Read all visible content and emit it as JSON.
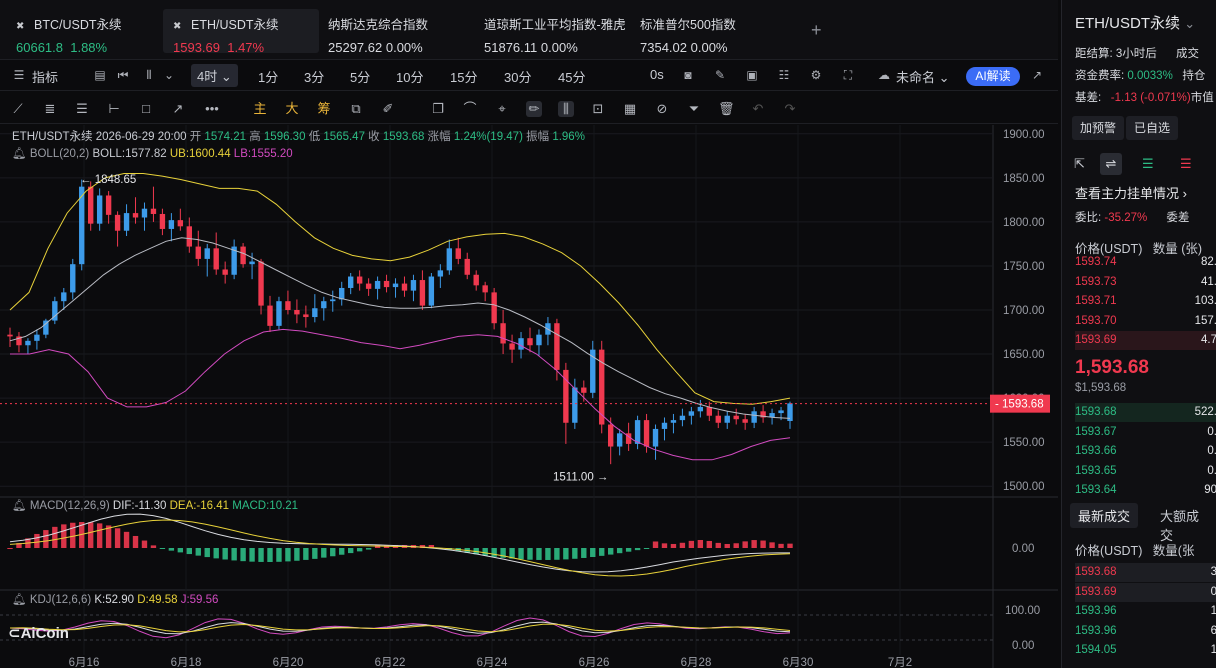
{
  "tabs": [
    {
      "name": "BTC/USDT永续",
      "price": "60661.8",
      "change": "1.88%",
      "dir": "up",
      "closable": true
    },
    {
      "name": "ETH/USDT永续",
      "price": "1593.69",
      "change": "1.47%",
      "dir": "down",
      "closable": true,
      "active": true
    },
    {
      "name": "纳斯达克综合指数",
      "price": "25297.62",
      "change": "0.00%",
      "dir": "flat"
    },
    {
      "name": "道琼斯工业平均指数-雅虎",
      "price": "51876.11",
      "change": "0.00%",
      "dir": "flat"
    },
    {
      "name": "标准普尔500指数",
      "price": "7354.02",
      "change": "0.00%",
      "dir": "flat"
    }
  ],
  "toolbar": {
    "indicator_label": "指标",
    "interval_selected": "4时",
    "intervals": [
      "1分",
      "3分",
      "5分",
      "10分",
      "15分",
      "30分",
      "45分"
    ],
    "interval_0s": "0s",
    "layout_name": "未命名",
    "ai_label": "AI解读"
  },
  "draw_tools": {
    "main": "主",
    "big": "大",
    "chip": "筹"
  },
  "legend": {
    "symbol": "ETH/USDT永续",
    "time": "2026-06-29 20:00",
    "open_label": "开",
    "open": "1574.21",
    "high_label": "高",
    "high": "1596.30",
    "low_label": "低",
    "low": "1565.47",
    "close_label": "收",
    "close": "1593.68",
    "chg_label": "涨幅",
    "chg": "1.24%(19.47)",
    "amp_label": "振幅",
    "amp": "1.96%",
    "boll_name": "BOLL(20,2)",
    "boll_val": "BOLL:1577.82",
    "boll_ub": "UB:1600.44",
    "boll_lb": "LB:1555.20",
    "macd_name": "MACD(12,26,9)",
    "macd_dif": "DIF:-11.30",
    "macd_dea": "DEA:-16.41",
    "macd_macd": "MACD:10.21",
    "kdj_name": "KDJ(12,6,6)",
    "kdj_k": "K:52.90",
    "kdj_d": "D:49.58",
    "kdj_j": "J:59.56"
  },
  "logo_text": "AiCoin",
  "colors": {
    "up": "#2dbd85",
    "down": "#f0394f",
    "candle_up": "#3d9be9",
    "candle_down": "#f0394f",
    "boll_mid": "#b9bcc4",
    "boll_ub": "#e8d23a",
    "boll_lb": "#d24bc0"
  },
  "chart_data": {
    "type": "candlestick",
    "price_axis_ticks": [
      "1900.00",
      "1850.00",
      "1800.00",
      "1750.00",
      "1700.00",
      "1650.00",
      "1600.00",
      "1550.00",
      "1500.00"
    ],
    "price_range": [
      1490,
      1910
    ],
    "current_price_label": "1593.68",
    "high_marker": "← 1848.65",
    "low_marker": "1511.00 →",
    "macd_axis_label": "0.00",
    "kdj_axis_ticks": [
      "100.00",
      "0.00"
    ],
    "x_labels": [
      "6月16",
      "6月18",
      "6月20",
      "6月22",
      "6月24",
      "6月26",
      "6月28",
      "6月30",
      "7月2"
    ],
    "candles": [
      [
        1672,
        1680,
        1658,
        1670
      ],
      [
        1670,
        1675,
        1652,
        1660
      ],
      [
        1660,
        1668,
        1650,
        1665
      ],
      [
        1665,
        1678,
        1655,
        1672
      ],
      [
        1672,
        1690,
        1668,
        1688
      ],
      [
        1688,
        1715,
        1684,
        1710
      ],
      [
        1710,
        1725,
        1700,
        1720
      ],
      [
        1720,
        1758,
        1712,
        1752
      ],
      [
        1752,
        1848,
        1745,
        1840
      ],
      [
        1840,
        1846,
        1790,
        1798
      ],
      [
        1798,
        1838,
        1790,
        1830
      ],
      [
        1830,
        1835,
        1798,
        1808
      ],
      [
        1808,
        1812,
        1772,
        1790
      ],
      [
        1790,
        1820,
        1784,
        1810
      ],
      [
        1810,
        1828,
        1798,
        1805
      ],
      [
        1805,
        1822,
        1790,
        1815
      ],
      [
        1815,
        1840,
        1800,
        1809
      ],
      [
        1809,
        1815,
        1785,
        1792
      ],
      [
        1792,
        1810,
        1778,
        1802
      ],
      [
        1802,
        1815,
        1790,
        1795
      ],
      [
        1795,
        1805,
        1765,
        1772
      ],
      [
        1772,
        1790,
        1750,
        1758
      ],
      [
        1758,
        1775,
        1738,
        1770
      ],
      [
        1770,
        1788,
        1740,
        1746
      ],
      [
        1746,
        1755,
        1730,
        1740
      ],
      [
        1740,
        1780,
        1735,
        1772
      ],
      [
        1772,
        1776,
        1748,
        1752
      ],
      [
        1752,
        1765,
        1735,
        1755
      ],
      [
        1755,
        1758,
        1695,
        1705
      ],
      [
        1705,
        1716,
        1675,
        1682
      ],
      [
        1682,
        1715,
        1678,
        1710
      ],
      [
        1710,
        1722,
        1695,
        1700
      ],
      [
        1700,
        1712,
        1685,
        1695
      ],
      [
        1695,
        1705,
        1680,
        1692
      ],
      [
        1692,
        1718,
        1686,
        1702
      ],
      [
        1702,
        1715,
        1688,
        1710
      ],
      [
        1710,
        1722,
        1698,
        1712
      ],
      [
        1712,
        1732,
        1705,
        1725
      ],
      [
        1725,
        1742,
        1718,
        1738
      ],
      [
        1738,
        1745,
        1722,
        1730
      ],
      [
        1730,
        1736,
        1716,
        1724
      ],
      [
        1724,
        1738,
        1712,
        1733
      ],
      [
        1733,
        1740,
        1720,
        1726
      ],
      [
        1726,
        1736,
        1714,
        1730
      ],
      [
        1730,
        1738,
        1715,
        1722
      ],
      [
        1722,
        1740,
        1710,
        1734
      ],
      [
        1734,
        1745,
        1700,
        1705
      ],
      [
        1705,
        1742,
        1702,
        1738
      ],
      [
        1738,
        1752,
        1725,
        1745
      ],
      [
        1745,
        1780,
        1740,
        1770
      ],
      [
        1770,
        1782,
        1752,
        1758
      ],
      [
        1758,
        1765,
        1735,
        1740
      ],
      [
        1740,
        1745,
        1722,
        1728
      ],
      [
        1728,
        1732,
        1710,
        1720
      ],
      [
        1720,
        1725,
        1678,
        1685
      ],
      [
        1685,
        1700,
        1650,
        1662
      ],
      [
        1662,
        1672,
        1640,
        1655
      ],
      [
        1655,
        1675,
        1645,
        1668
      ],
      [
        1668,
        1680,
        1652,
        1660
      ],
      [
        1660,
        1678,
        1648,
        1672
      ],
      [
        1672,
        1692,
        1660,
        1685
      ],
      [
        1685,
        1690,
        1620,
        1632
      ],
      [
        1632,
        1640,
        1548,
        1572
      ],
      [
        1572,
        1622,
        1565,
        1612
      ],
      [
        1612,
        1620,
        1596,
        1606
      ],
      [
        1606,
        1665,
        1600,
        1655
      ],
      [
        1655,
        1665,
        1560,
        1570
      ],
      [
        1570,
        1578,
        1525,
        1545
      ],
      [
        1545,
        1565,
        1535,
        1560
      ],
      [
        1560,
        1572,
        1540,
        1548
      ],
      [
        1548,
        1580,
        1542,
        1575
      ],
      [
        1575,
        1582,
        1538,
        1545
      ],
      [
        1545,
        1570,
        1530,
        1565
      ],
      [
        1565,
        1578,
        1552,
        1572
      ],
      [
        1572,
        1582,
        1560,
        1575
      ],
      [
        1575,
        1588,
        1568,
        1580
      ],
      [
        1580,
        1590,
        1570,
        1585
      ],
      [
        1585,
        1598,
        1578,
        1590
      ],
      [
        1590,
        1596,
        1574,
        1580
      ],
      [
        1580,
        1586,
        1566,
        1572
      ],
      [
        1572,
        1585,
        1565,
        1580
      ],
      [
        1580,
        1588,
        1570,
        1576
      ],
      [
        1576,
        1582,
        1564,
        1572
      ],
      [
        1572,
        1590,
        1566,
        1585
      ],
      [
        1585,
        1592,
        1572,
        1578
      ],
      [
        1578,
        1588,
        1570,
        1583
      ],
      [
        1583,
        1590,
        1575,
        1586
      ],
      [
        1574,
        1596,
        1565,
        1594
      ]
    ],
    "boll_mid": [
      1665,
      1670,
      1680,
      1695,
      1710,
      1725,
      1740,
      1752,
      1762,
      1770,
      1778,
      1782,
      1780,
      1776,
      1770,
      1764,
      1755,
      1746,
      1737,
      1728,
      1720,
      1714,
      1710,
      1706,
      1703,
      1702,
      1702,
      1703,
      1705,
      1706,
      1708,
      1706,
      1700,
      1692,
      1683,
      1673,
      1663,
      1651,
      1640,
      1630,
      1621,
      1612,
      1605,
      1600,
      1594,
      1589,
      1585,
      1582,
      1580,
      1578,
      1577
    ],
    "boll_ub": [
      1700,
      1720,
      1770,
      1810,
      1835,
      1850,
      1855,
      1855,
      1852,
      1848,
      1843,
      1838,
      1838,
      1835,
      1820,
      1800,
      1782,
      1770,
      1762,
      1758,
      1756,
      1760,
      1768,
      1778,
      1783,
      1786,
      1787,
      1783,
      1775,
      1765,
      1750,
      1730,
      1708,
      1683,
      1655,
      1630,
      1606,
      1596,
      1594,
      1593,
      1596,
      1600
    ],
    "boll_lb": [
      1650,
      1650,
      1655,
      1650,
      1630,
      1600,
      1590,
      1590,
      1595,
      1608,
      1630,
      1650,
      1665,
      1675,
      1678,
      1676,
      1672,
      1668,
      1663,
      1660,
      1656,
      1660,
      1665,
      1670,
      1672,
      1670,
      1662,
      1650,
      1632,
      1610,
      1588,
      1568,
      1552,
      1542,
      1535,
      1530,
      1530,
      1536,
      1545,
      1552,
      1555
    ]
  },
  "right_panel": {
    "title": "ETH/USDT永续",
    "settle_label": "距结算:",
    "settle_value": "3小时后",
    "settle_extra": "成交",
    "funding_label": "资金费率:",
    "funding_value": "0.0033%",
    "funding_extra": "持仓",
    "basis_label": "基差:",
    "basis_value": "-1.13 (-0.071%)",
    "basis_extra": "市值",
    "btn_alert": "加预警",
    "btn_fav": "已自选",
    "orderbook_title": "查看主力挂单情况",
    "weibi_label": "委比:",
    "weibi_value": "-35.27%",
    "weibi_extra": "委差",
    "col_price": "价格(USDT)",
    "col_qty": "数量 (张)",
    "asks": [
      [
        "1593.74",
        "82."
      ],
      [
        "1593.73",
        "41."
      ],
      [
        "1593.71",
        "103."
      ],
      [
        "1593.70",
        "157."
      ],
      [
        "1593.69",
        "4.7"
      ]
    ],
    "last_price": "1,593.68",
    "last_price_usd": "$1,593.68",
    "bids": [
      [
        "1593.68",
        "522."
      ],
      [
        "1593.67",
        "0."
      ],
      [
        "1593.66",
        "0."
      ],
      [
        "1593.65",
        "0."
      ],
      [
        "1593.64",
        "90"
      ]
    ],
    "tab_latest": "最新成交",
    "tab_big": "大额成交",
    "trades_col_price": "价格(USDT)",
    "trades_col_qty": "数量(张",
    "trades": [
      [
        "1593.68",
        "3",
        "down"
      ],
      [
        "1593.69",
        "0",
        "down"
      ],
      [
        "1593.96",
        "1",
        "up"
      ],
      [
        "1593.96",
        "6",
        "up"
      ],
      [
        "1594.05",
        "1",
        "up"
      ]
    ]
  }
}
